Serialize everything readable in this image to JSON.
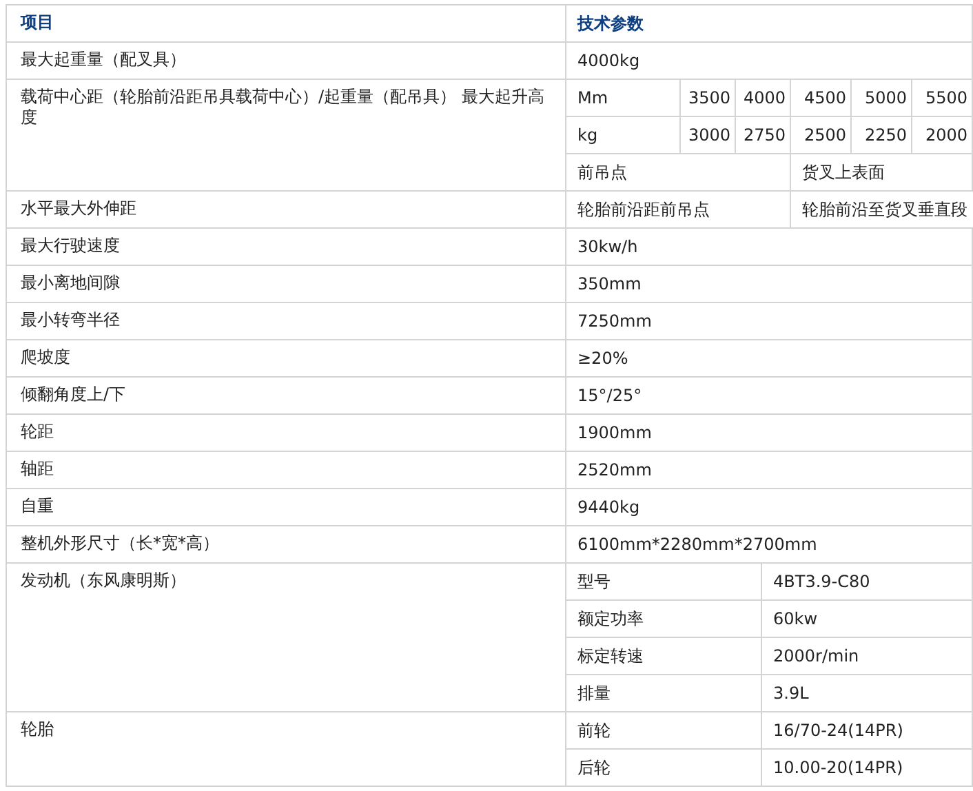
{
  "header": [
    "项目",
    "技术参数"
  ],
  "sections": [
    {
      "label": "最大起重量（配叉具）",
      "kind": "single",
      "rows": [
        [
          "4000kg"
        ]
      ]
    },
    {
      "label": "载荷中心距（轮胎前沿距吊具载荷中心）/起重量（配吊具） 最大起升高度",
      "kind": "load",
      "rows": [
        [
          "Mm",
          "3500",
          "4000",
          "4500",
          "5000",
          "5500"
        ],
        [
          "kg",
          "3000",
          "2750",
          "2500",
          "2250",
          "2000"
        ],
        [
          "前吊点",
          "",
          "",
          "货叉上表面",
          "",
          ""
        ]
      ]
    },
    {
      "label": "水平最大外伸距",
      "kind": "halves",
      "rows": [
        [
          "轮胎前沿距前吊点",
          "轮胎前沿至货叉垂直段"
        ]
      ]
    },
    {
      "label": "最大行驶速度",
      "kind": "single",
      "rows": [
        [
          "30kw/h"
        ]
      ]
    },
    {
      "label": "最小离地间隙",
      "kind": "single",
      "rows": [
        [
          "350mm"
        ]
      ]
    },
    {
      "label": "最小转弯半径",
      "kind": "single",
      "rows": [
        [
          "7250mm"
        ]
      ]
    },
    {
      "label": "爬坡度",
      "kind": "single",
      "rows": [
        [
          "≥20%"
        ]
      ]
    },
    {
      "label": "倾翻角度上/下",
      "kind": "single",
      "rows": [
        [
          "15°/25°"
        ]
      ]
    },
    {
      "label": "轮距",
      "kind": "single",
      "rows": [
        [
          "1900mm"
        ]
      ]
    },
    {
      "label": "轴距",
      "kind": "single",
      "rows": [
        [
          "2520mm"
        ]
      ]
    },
    {
      "label": "自重",
      "kind": "single",
      "rows": [
        [
          "9440kg"
        ]
      ]
    },
    {
      "label": "整机外形尺寸（长*宽*高）",
      "kind": "single",
      "rows": [
        [
          "6100mm*2280mm*2700mm"
        ]
      ]
    },
    {
      "label": "发动机（东风康明斯）",
      "kind": "pair",
      "rows": [
        [
          "型号",
          "4BT3.9-C80"
        ],
        [
          "额定功率",
          "60kw"
        ],
        [
          "标定转速",
          "2000r/min"
        ],
        [
          "排量",
          "3.9L"
        ]
      ]
    },
    {
      "label": "轮胎",
      "kind": "pair",
      "rows": [
        [
          "前轮",
          "16/70-24(14PR)"
        ],
        [
          "后轮",
          "10.00-20(14PR)"
        ]
      ]
    }
  ]
}
